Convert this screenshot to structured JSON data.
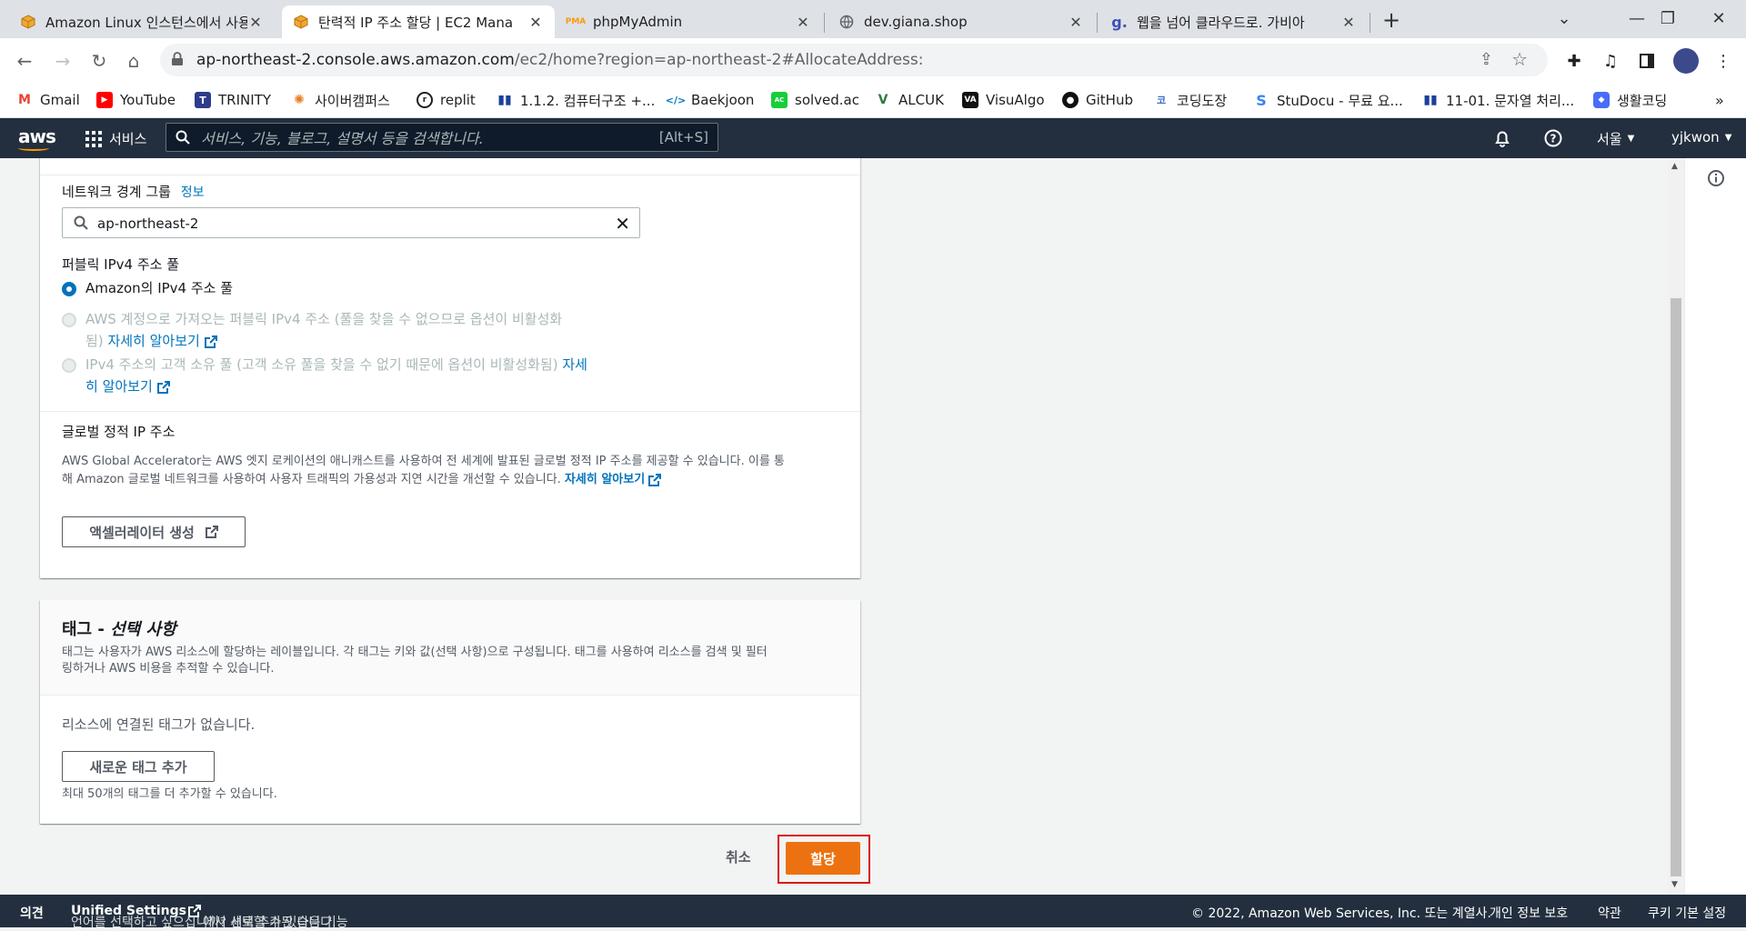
{
  "browser": {
    "tabs": [
      {
        "title": "Amazon Linux 인스턴스에서 사용",
        "active": false
      },
      {
        "title": "탄력적 IP 주소 할당 | EC2 Mana",
        "active": true
      },
      {
        "title": "phpMyAdmin",
        "active": false
      },
      {
        "title": "dev.giana.shop",
        "active": false
      },
      {
        "title": "웹을 넘어 클라우드로. 가비아",
        "active": false
      }
    ],
    "url_host": "ap-northeast-2.console.aws.amazon.com",
    "url_path": "/ec2/home?region=ap-northeast-2#AllocateAddress:",
    "bookmarks": [
      "Gmail",
      "YouTube",
      "TRINITY",
      "사이버캠퍼스",
      "replit",
      "1.1.2. 컴퓨터구조 +...",
      "Baekjoon",
      "solved.ac",
      "ALCUK",
      "VisuAlgo",
      "GitHub",
      "코딩도장",
      "StuDocu - 무료 요...",
      "11-01. 문자열 처리...",
      "생활코딩"
    ],
    "bookmark_more": "»"
  },
  "aws_nav": {
    "logo": "aws",
    "services_label": "서비스",
    "search_placeholder": "서비스, 기능, 블로그, 설명서 등을 검색합니다.",
    "search_shortcut": "[Alt+S]",
    "region": "서울",
    "user": "yjkwon"
  },
  "form": {
    "network_border_group_label": "네트워크 경계 그룹",
    "info_link": "정보",
    "network_border_group_value": "ap-northeast-2",
    "public_ipv4_pool_label": "퍼블릭 IPv4 주소 풀",
    "pool_options": [
      {
        "text": "Amazon의 IPv4 주소 풀",
        "selected": true,
        "disabled": false
      },
      {
        "text_line1": "AWS 계정으로 가져오는 퍼블릭 IPv4 주소 (풀을 찾을 수 없으므로 옵션이 비활성화",
        "text_line2": "됨)",
        "link": "자세히 알아보기",
        "selected": false,
        "disabled": true
      },
      {
        "text_line1": "IPv4 주소의 고객 소유 풀 (고객 소유 풀을 찾을 수 없기 때문에 옵션이 비활성화됨)",
        "link_part1": "자세",
        "link_part2": "히 알아보기",
        "selected": false,
        "disabled": true
      }
    ],
    "global_static_ip_label": "글로벌 정적 IP 주소",
    "global_desc_line1": "AWS Global Accelerator는 AWS 엣지 로케이션의 애니캐스트를 사용하여 전 세계에 발표된 글로벌 정적 IP 주소를 제공할 수 있습니다. 이를 통",
    "global_desc_line2": "해 Amazon 글로벌 네트워크를 사용하여 사용자 트래픽의 가용성과 지연 시간을 개선할 수 있습니다.",
    "global_desc_link": "자세히 알아보기",
    "create_accelerator_button": "액셀러레이터 생성"
  },
  "tags": {
    "title_main": "태그 - ",
    "title_optional": "선택 사항",
    "desc_line1": "태그는 사용자가 AWS 리소스에 할당하는 레이블입니다. 각 태그는 키와 값(선택 사항)으로 구성됩니다. 태그를 사용하여 리소스를 검색 및 필터",
    "desc_line2": "링하거나 AWS 비용을 추적할 수 있습니다.",
    "empty_text": "리소스에 연결된 태그가 없습니다.",
    "add_tag_button": "새로운 태그 추가",
    "limit_text": "최대 50개의 태그를 더 추가할 수 있습니다."
  },
  "actions": {
    "cancel": "취소",
    "allocate": "할당"
  },
  "footer": {
    "feedback": "의견",
    "language_prompt_pre": "언어를 선택하고 싶으십니까? 새로 추가된 다음 기능",
    "unified_settings": "Unified Settings",
    "language_prompt_post": "에서 선택할 수 있습니다.",
    "copyright": "© 2022, Amazon Web Services, Inc. 또는 계열사.",
    "privacy": "개인 정보 보호",
    "terms": "약관",
    "cookies": "쿠키 기본 설정"
  },
  "colors": {
    "aws_nav": "#232f3e",
    "primary_button": "#ec7211",
    "link": "#0073bb",
    "highlight_box": "#d91515"
  }
}
